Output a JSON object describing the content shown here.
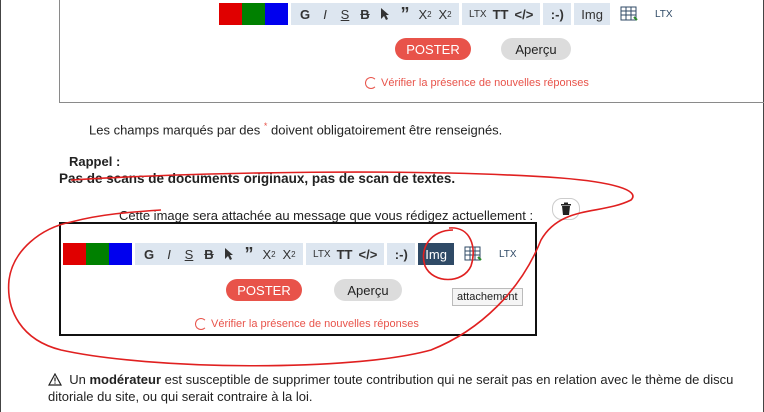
{
  "toolbar": {
    "colors": [
      "#e00000",
      "#008000",
      "#0000ee"
    ],
    "bold": "G",
    "italic": "I",
    "strike": "S",
    "strike_b": "B",
    "quote": "”",
    "sub_base": "X",
    "sub_mark": "2",
    "sup_base": "X",
    "sup_mark": "2",
    "latex_small": "LTX",
    "tt": "TT",
    "code": "</>",
    "smiley": ":-)",
    "img": "Img",
    "latex_mini": "LTX"
  },
  "post_button": "POSTER",
  "preview_button": "Aperçu",
  "check_link": "Vérifier la présence de nouvelles réponses",
  "required_note_before": "Les champs marqués par des",
  "required_star": "*",
  "required_note_after": "doivent obligatoirement être renseignés.",
  "reminder_title": "Rappel :",
  "reminder_text": "Pas de scans de documents originaux, pas de scan de textes.",
  "attach_text": "Cette image sera attachée au message que vous rédigez actuellement :",
  "tooltip": "attachement",
  "moderator_before": "Un",
  "moderator_bold": "modérateur",
  "moderator_after": "est susceptible de supprimer toute contribution qui ne serait pas en relation avec le thème de discu",
  "moderator_line2": "ditoriale du site, ou qui serait contraire à la loi.",
  "colors": {
    "accent": "#e8534a",
    "toolbar_bg": "#dde6f0",
    "active": "#2f4a66",
    "annotation": "#e02020"
  }
}
